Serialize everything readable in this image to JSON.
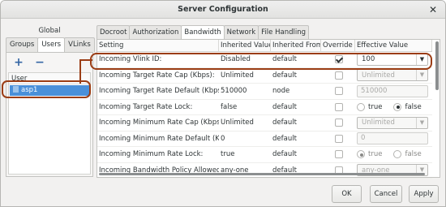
{
  "window": {
    "title": "Server Configuration",
    "close_glyph": "✕"
  },
  "left": {
    "group_label": "Global",
    "tabs": [
      "Groups",
      "Users",
      "VLinks"
    ],
    "active_tab": "Users",
    "add_glyph": "+",
    "remove_glyph": "−",
    "list_header": "User",
    "users": [
      "asp1"
    ]
  },
  "right": {
    "tabs": [
      "Docroot",
      "Authorization",
      "Bandwidth",
      "Network",
      "File Handling"
    ],
    "active_tab": "Bandwidth",
    "columns": [
      "Setting",
      "Inherited Value",
      "Inherited From",
      "Override",
      "Effective Value"
    ],
    "rows": [
      {
        "setting": "Incoming Vlink ID:",
        "inherited": "Disabled",
        "from": "default",
        "override": true,
        "effective_type": "combo",
        "effective": "100",
        "enabled": true
      },
      {
        "setting": "Incoming Target Rate Cap (Kbps):",
        "inherited": "Unlimited",
        "from": "default",
        "override": false,
        "effective_type": "combo",
        "effective": "Unlimited",
        "enabled": false
      },
      {
        "setting": "Incoming Target Rate Default (Kbps):",
        "inherited": "510000",
        "from": "node",
        "override": false,
        "effective_type": "entry",
        "effective": "510000",
        "enabled": false
      },
      {
        "setting": "Incoming Target Rate Lock:",
        "inherited": "false",
        "from": "default",
        "override": false,
        "effective_type": "radio",
        "options": [
          "true",
          "false"
        ],
        "selected": "false",
        "enabled": true
      },
      {
        "setting": "Incoming Minimum Rate Cap (Kbps):",
        "inherited": "Unlimited",
        "from": "default",
        "override": false,
        "effective_type": "combo",
        "effective": "Unlimited",
        "enabled": false
      },
      {
        "setting": "Incoming Minimum Rate Default (Kbps):",
        "inherited": "0",
        "from": "default",
        "override": false,
        "effective_type": "entry",
        "effective": "0",
        "enabled": false
      },
      {
        "setting": "Incoming Minimum Rate Lock:",
        "inherited": "true",
        "from": "default",
        "override": false,
        "effective_type": "radio",
        "options": [
          "true",
          "false"
        ],
        "selected": "true",
        "enabled": false
      },
      {
        "setting": "Incoming Bandwidth Policy Allowed:",
        "inherited": "any-one",
        "from": "default",
        "override": false,
        "effective_type": "combo",
        "effective": "any-one",
        "enabled": false
      }
    ]
  },
  "buttons": {
    "ok": "OK",
    "cancel": "Cancel",
    "apply": "Apply"
  },
  "colors": {
    "highlight": "#9b3d15",
    "selection": "#4a90d9",
    "accent_icon": "#3465a4"
  }
}
